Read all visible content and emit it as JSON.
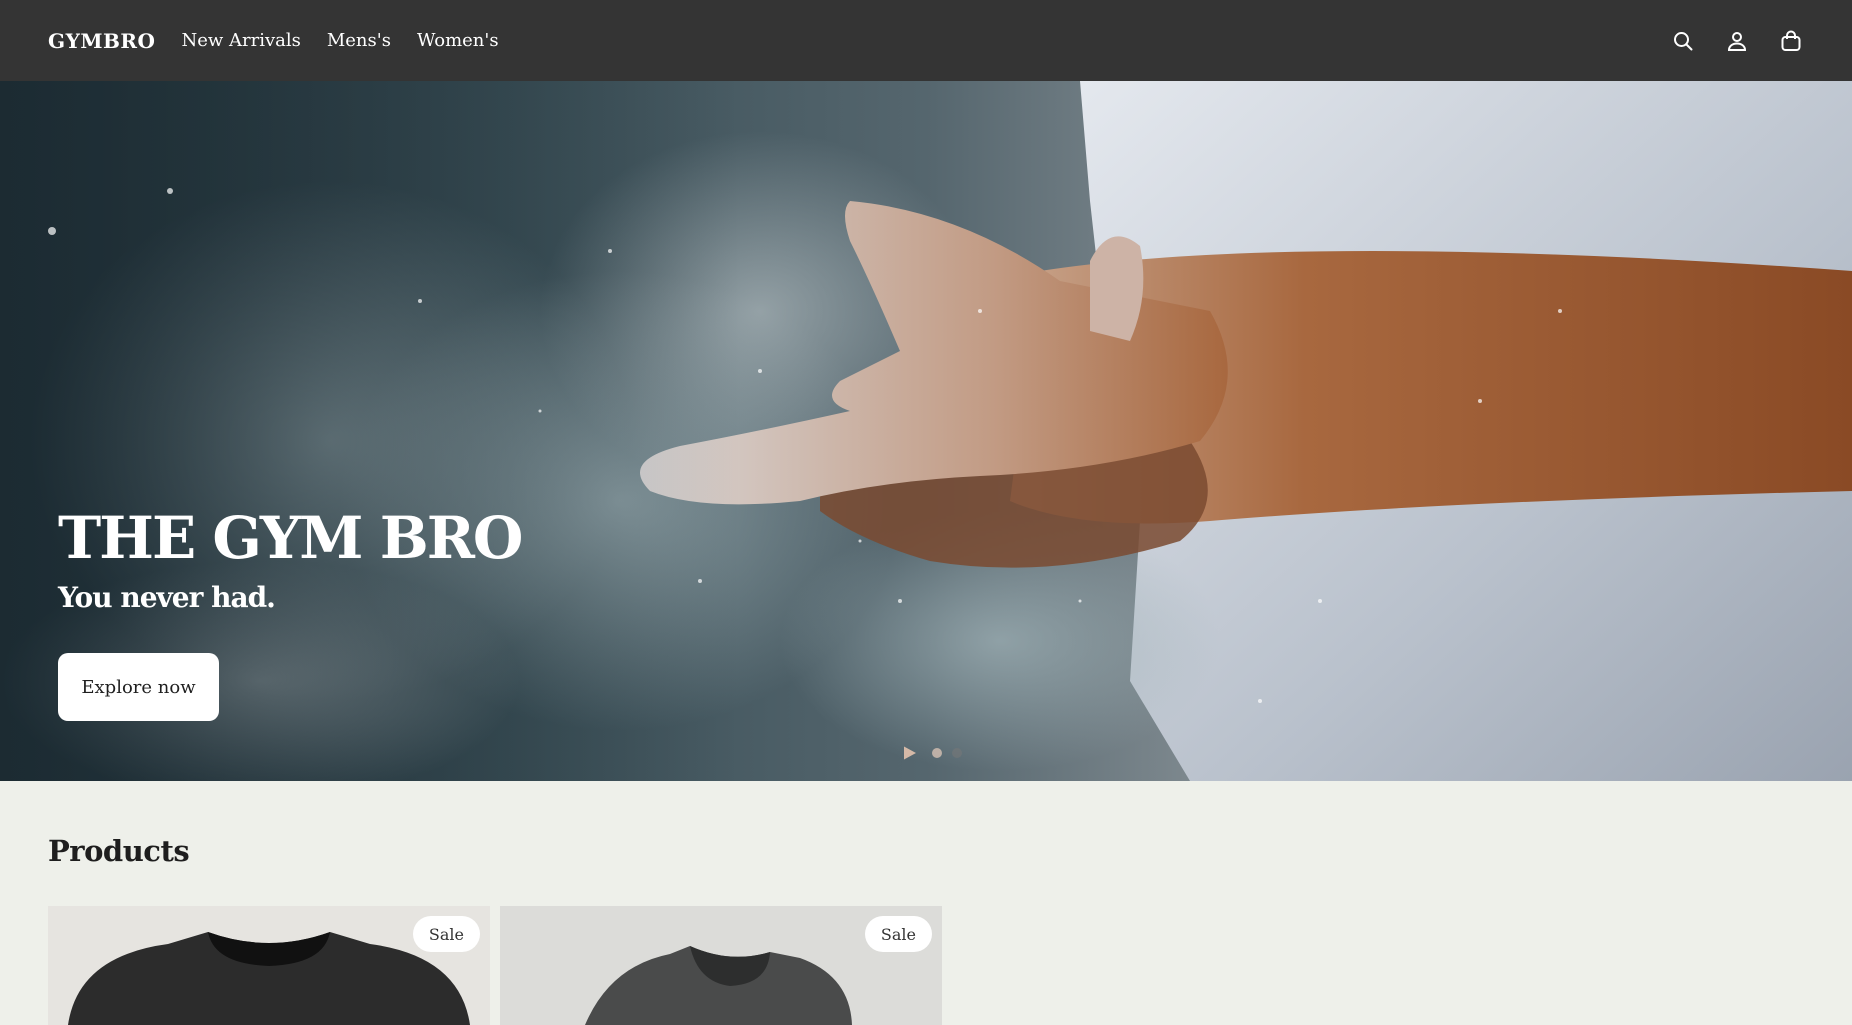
{
  "header": {
    "logo": "GYMBRO",
    "nav": [
      "New Arrivals",
      "Mens's",
      "Women's"
    ],
    "icons": [
      "search-icon",
      "account-icon",
      "cart-icon"
    ]
  },
  "hero": {
    "title": "THE GYM BRO",
    "subtitle": "You never had.",
    "cta_label": "Explore now",
    "slider": {
      "slide_count": 2,
      "active_slide": 1
    }
  },
  "products": {
    "title": "Products",
    "items": [
      {
        "badge": "Sale"
      },
      {
        "badge": "Sale"
      }
    ]
  },
  "colors": {
    "header_bg": "#343434",
    "page_bg": "#eef0ea",
    "button_bg": "#ffffff"
  }
}
